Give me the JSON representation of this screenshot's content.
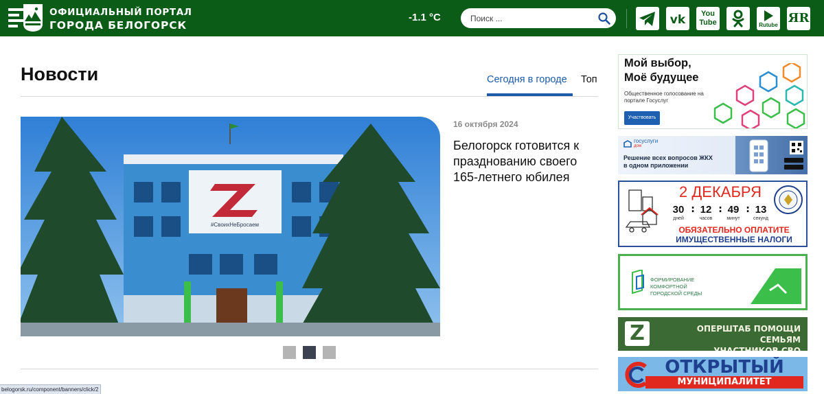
{
  "header": {
    "logo_line1": "ОФИЦИАЛЬНЫЙ ПОРТАЛ",
    "logo_line2": "ГОРОДА БЕЛОГОРСК",
    "temperature": "-1.1 °C",
    "search_placeholder": "Поиск ...",
    "socials": [
      {
        "name": "telegram-icon"
      },
      {
        "name": "vk-icon"
      },
      {
        "name": "youtube-icon",
        "label_top": "You",
        "label_bottom": "Tube"
      },
      {
        "name": "odnoklassniki-icon"
      },
      {
        "name": "rutube-icon",
        "label": "Rutube"
      },
      {
        "name": "yandex-icon",
        "label": "ЯR"
      }
    ]
  },
  "main": {
    "title": "Новости",
    "tabs": [
      {
        "label": "Сегодня в городе",
        "active": true
      },
      {
        "label": "Топ",
        "active": false
      }
    ],
    "slide": {
      "date": "16 октября 2024",
      "title": "Белогорск готовится к празднованию своего 165-летнего юбилея",
      "banner_text": "#СвоихНеБросаем"
    },
    "pager": {
      "count": 3,
      "active_index": 1
    }
  },
  "sidebar": {
    "banner1": {
      "title_line1": "Мой выбор,",
      "title_line2": "Моё будущее",
      "subtitle_line1": "Общественное голосование на",
      "subtitle_line2": "портале Госуслуг",
      "button": "Участвовать"
    },
    "banner2": {
      "brand": "госуслуги",
      "brand_sub": "дом",
      "text_line1": "Решение всех вопросов ЖКХ",
      "text_line2": "в одном приложении"
    },
    "banner3": {
      "date": "2 ДЕКАБРЯ",
      "timer": [
        {
          "value": "30",
          "unit": "дней"
        },
        {
          "value": "12",
          "unit": "часов"
        },
        {
          "value": "49",
          "unit": "минут"
        },
        {
          "value": "13",
          "unit": "секунд"
        }
      ],
      "line1": "ОБЯЗАТЕЛЬНО ОПЛАТИТЕ",
      "line2": "ИМУЩЕСТВЕННЫЕ НАЛОГИ"
    },
    "banner4": {
      "line1": "ФОРМИРОВАНИЕ",
      "line2": "КОМФОРТНОЙ",
      "line3": "ГОРОДСКОЙ СРЕДЫ"
    },
    "banner5": {
      "line1": "ОПЕРШТАБ ПОМОЩИ СЕМЬЯМ",
      "line2": "УЧАСТНИКОВ СВО"
    },
    "banner6": {
      "line1": "ОТКРЫТЫЙ",
      "line2": "МУНИЦИПАЛИТЕТ"
    }
  },
  "status_bar": {
    "url": "belogorsk.ru/component/banners/click/2"
  },
  "colors": {
    "header_green": "#0a5c17",
    "link_blue": "#1c5ba8",
    "tax_red": "#e0281e",
    "tax_blue": "#1f3f8f"
  }
}
